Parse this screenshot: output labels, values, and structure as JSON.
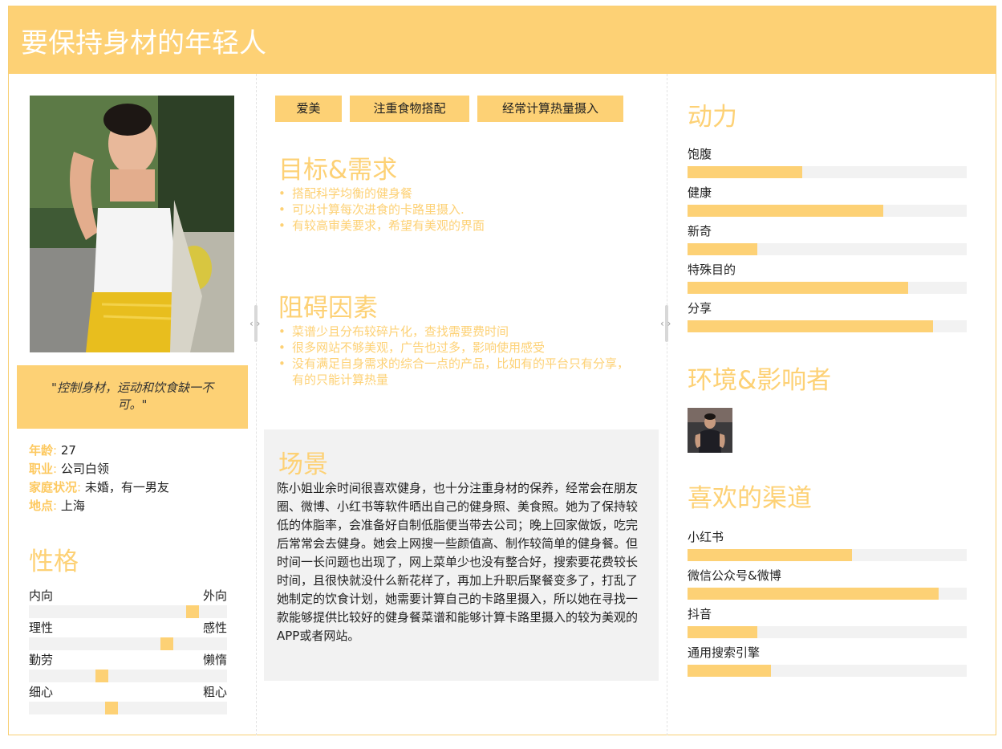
{
  "title": "要保持身材的年轻人",
  "quote": "\"控制身材，运动和饮食缺一不可。\"",
  "info": [
    {
      "key": "年龄",
      "sep": ":",
      "value": " 27"
    },
    {
      "key": "职业",
      "sep": ":",
      "value": " 公司白领"
    },
    {
      "key": "家庭状况",
      "sep": ":",
      "value": " 未婚，有一男友"
    },
    {
      "key": "地点",
      "sep": ":",
      "value": " 上海"
    }
  ],
  "personality": {
    "title": "性格",
    "traits": [
      {
        "left": "内向",
        "right": "外向",
        "level": 0.85
      },
      {
        "left": "理性",
        "right": "感性",
        "level": 0.71
      },
      {
        "left": "勤劳",
        "right": "懒惰",
        "level": 0.36
      },
      {
        "left": "细心",
        "right": "粗心",
        "level": 0.41
      }
    ]
  },
  "tags": [
    "爱美",
    "注重食物搭配",
    "经常计算热量摄入"
  ],
  "goals": {
    "title": "目标&需求",
    "items": [
      "搭配科学均衡的健身餐",
      "可以计算每次进食的卡路里摄入.",
      "有较高审美要求，希望有美观的界面"
    ]
  },
  "obstacles": {
    "title": "阻碍因素",
    "items": [
      "菜谱少且分布较碎片化，查找需要费时间",
      "很多网站不够美观，广告也过多，影响使用感受",
      "没有满足自身需求的综合一点的产品，比如有的平台只有分享，有的只能计算热量"
    ]
  },
  "scene": {
    "title": "场景",
    "text": "陈小姐业余时间很喜欢健身，也十分注重身材的保养，经常会在朋友圈、微博、小红书等软件晒出自己的健身照、美食照。她为了保持较低的体脂率，会准备好自制低脂便当带去公司；晚上回家做饭，吃完后常常会去健身。她会上网搜一些颜值高、制作较简单的健身餐。但时间一长问题也出现了，网上菜单少也没有整合好，搜索要花费较长时间，且很快就没什么新花样了，再加上升职后聚餐变多了，打乱了她制定的饮食计划，她需要计算自己的卡路里摄入，所以她在寻找一款能够提供比较好的健身餐菜谱和能够计算卡路里摄入的较为美观的APP或者网站。"
  },
  "motivation": {
    "title": "动力",
    "items": [
      {
        "label": "饱腹",
        "level": 0.41
      },
      {
        "label": "健康",
        "level": 0.7
      },
      {
        "label": "新奇",
        "level": 0.25
      },
      {
        "label": "特殊目的",
        "level": 0.79
      },
      {
        "label": "分享",
        "level": 0.88
      }
    ]
  },
  "environment": {
    "title": "环境&影响者"
  },
  "channels": {
    "title": "喜欢的渠道",
    "items": [
      {
        "label": "小红书",
        "level": 0.59
      },
      {
        "label": "微信公众号&微博",
        "level": 0.9
      },
      {
        "label": "抖音",
        "level": 0.25
      },
      {
        "label": "通用搜索引擎",
        "level": 0.3
      }
    ]
  },
  "colors": {
    "accent": "#fdd175",
    "track": "#f2f2f2",
    "text": "#222222"
  }
}
